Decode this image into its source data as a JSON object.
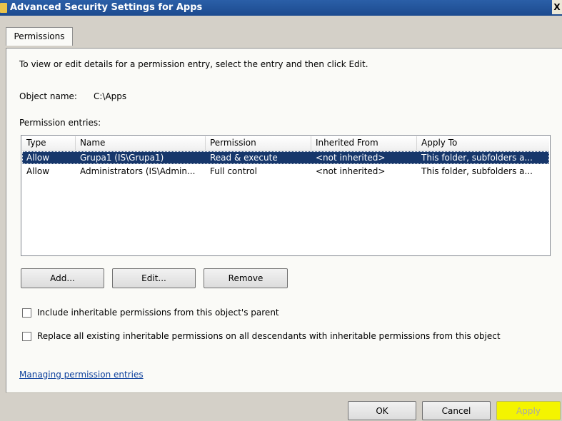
{
  "window": {
    "title": "Advanced Security Settings for Apps",
    "close_glyph": "X"
  },
  "tabs": [
    {
      "label": "Permissions"
    }
  ],
  "instruction": "To view or edit details for a permission entry, select the entry and then click Edit.",
  "object_name": {
    "label": "Object name:",
    "value": "C:\\Apps"
  },
  "entries_label": "Permission entries:",
  "table": {
    "columns": [
      "Type",
      "Name",
      "Permission",
      "Inherited From",
      "Apply To"
    ],
    "rows": [
      {
        "type": "Allow",
        "name": "Grupa1 (IS\\Grupa1)",
        "permission": "Read & execute",
        "inherited_from": "<not inherited>",
        "apply_to": "This folder, subfolders a...",
        "selected": true
      },
      {
        "type": "Allow",
        "name": "Administrators (IS\\Admin...",
        "permission": "Full control",
        "inherited_from": "<not inherited>",
        "apply_to": "This folder, subfolders a...",
        "selected": false
      }
    ]
  },
  "buttons": {
    "add": "Add...",
    "edit": "Edit...",
    "remove": "Remove",
    "ok": "OK",
    "cancel": "Cancel",
    "apply": "Apply"
  },
  "checkboxes": {
    "include_inheritable": {
      "label": "Include inheritable permissions from this object's parent",
      "checked": false
    },
    "replace_all": {
      "label": "Replace all existing inheritable permissions on all descendants with inheritable permissions from this object",
      "checked": false
    }
  },
  "link": "Managing permission entries",
  "colors": {
    "selection": "#17376b",
    "title_bar": "#2b5fa8",
    "apply_highlight": "#f4f400"
  }
}
